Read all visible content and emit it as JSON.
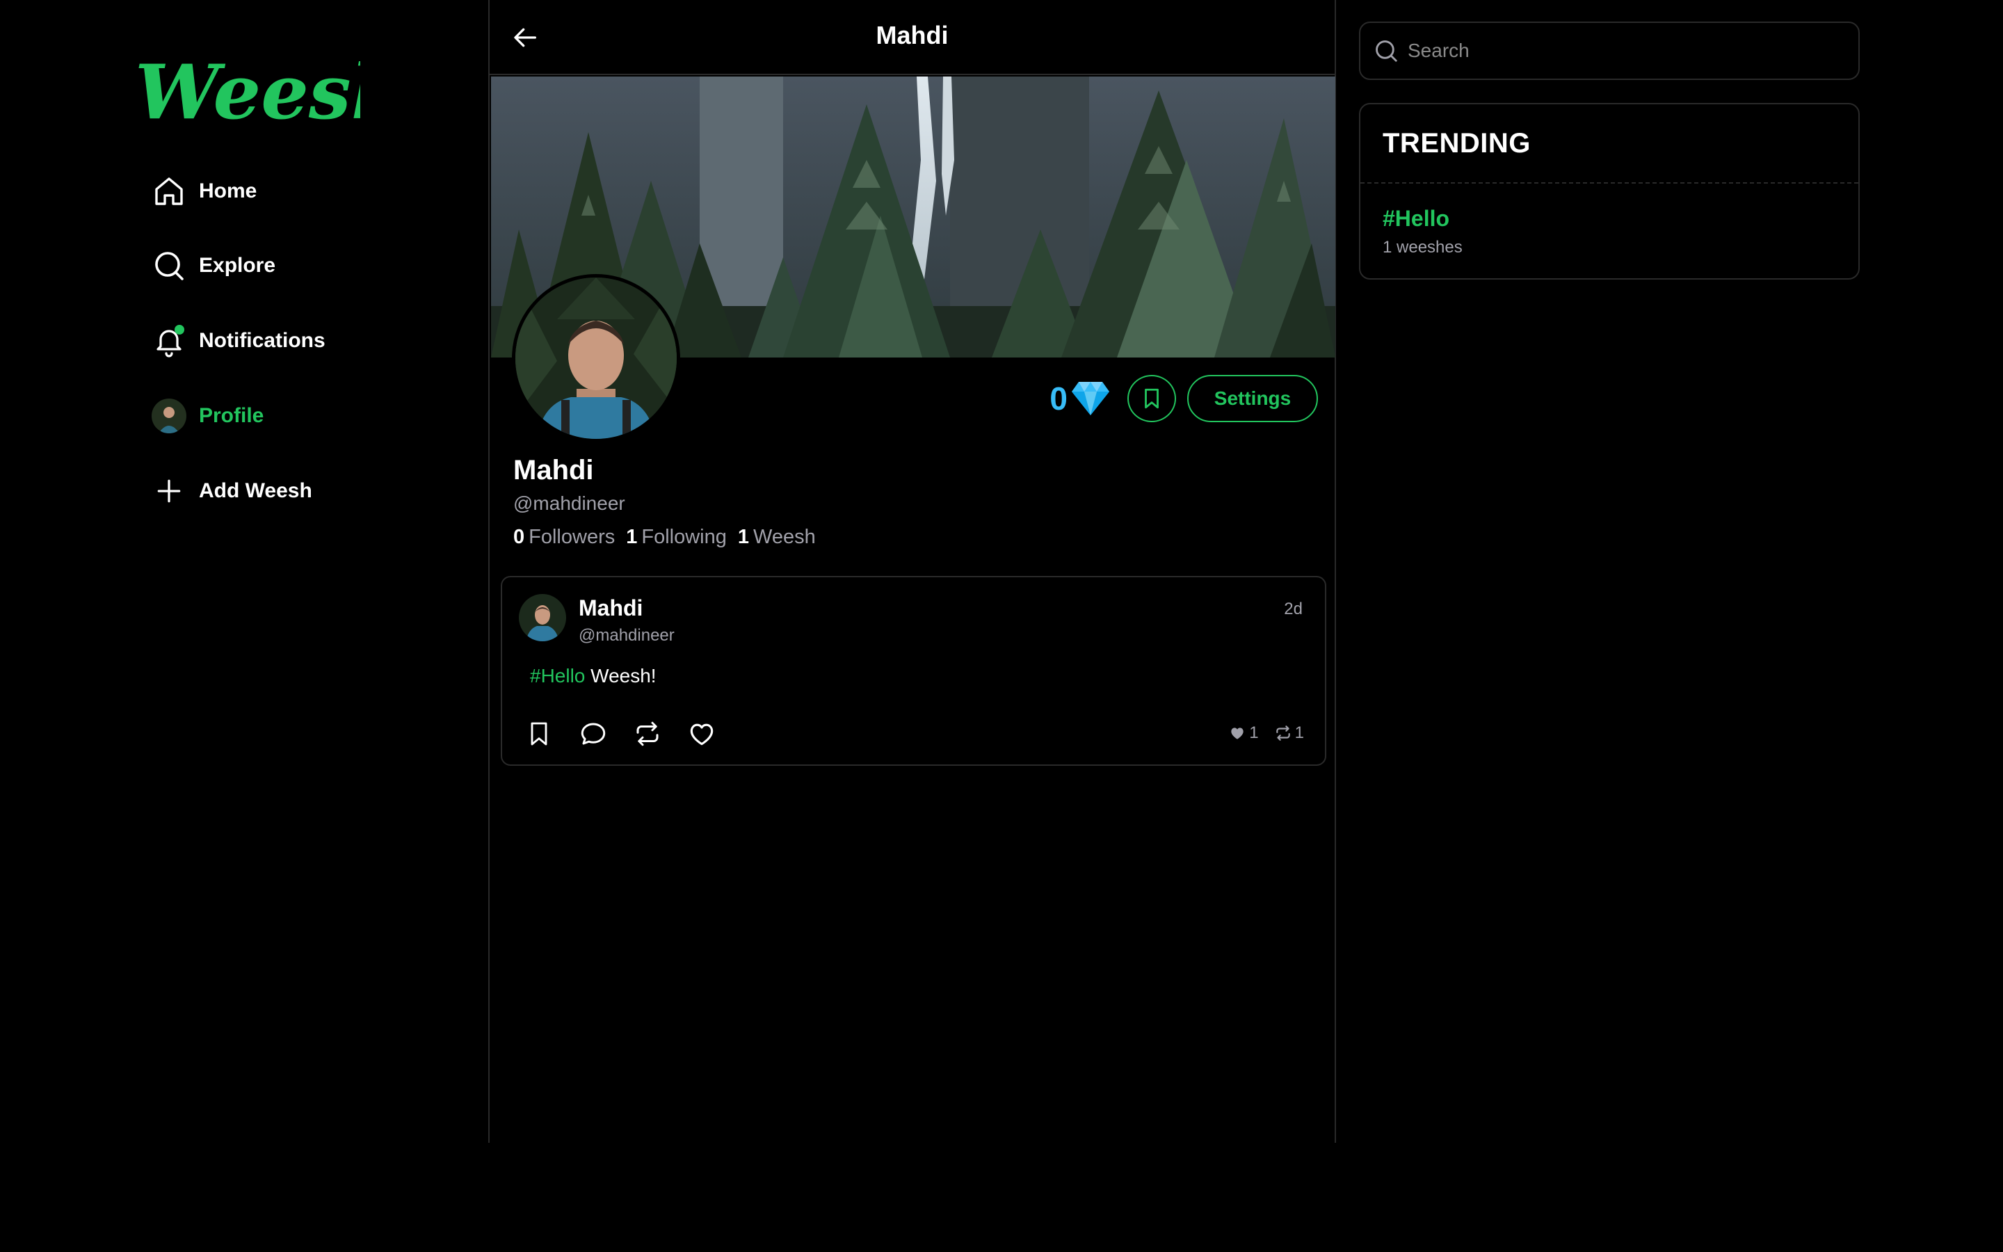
{
  "sidebar": {
    "logo_text": "Weesh",
    "items": [
      {
        "label": "Home",
        "icon": "home-icon"
      },
      {
        "label": "Explore",
        "icon": "search-icon"
      },
      {
        "label": "Notifications",
        "icon": "bell-icon"
      },
      {
        "label": "Profile",
        "icon": "avatar"
      },
      {
        "label": "Add Weesh",
        "icon": "plus-icon"
      }
    ]
  },
  "header": {
    "title": "Mahdi"
  },
  "profile": {
    "name": "Mahdi",
    "handle": "@mahdineer",
    "gems": "0",
    "settings_label": "Settings",
    "stats": [
      {
        "count": "0",
        "label": "Followers"
      },
      {
        "count": "1",
        "label": "Following"
      },
      {
        "count": "1",
        "label": "Weesh"
      }
    ]
  },
  "post": {
    "name": "Mahdi",
    "handle": "@mahdineer",
    "time": "2d",
    "hashtag": "#Hello",
    "text": " Weesh!",
    "likes": "1",
    "reweesh": "1"
  },
  "search": {
    "placeholder": "Search"
  },
  "trending": {
    "title": "TRENDING",
    "items": [
      {
        "tag": "#Hello",
        "count": "1 weeshes"
      }
    ]
  },
  "colors": {
    "accent": "#22c55e",
    "background": "#000000",
    "border": "#2a2a2a",
    "gem": "#38bdf8"
  }
}
